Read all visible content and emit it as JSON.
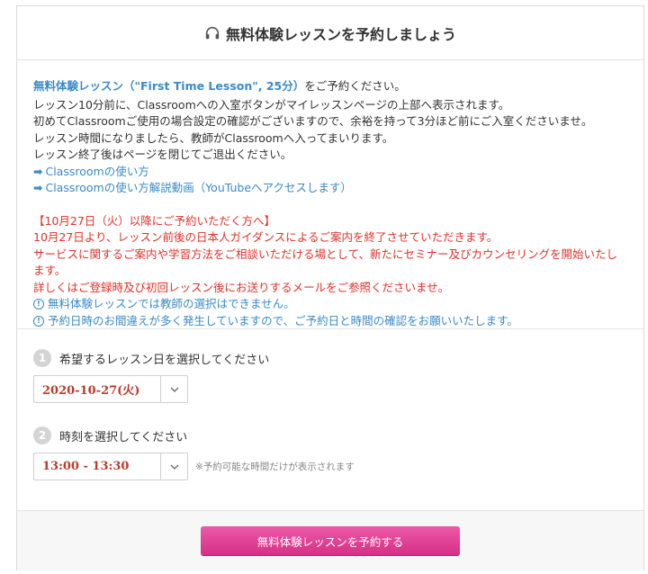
{
  "header": {
    "title": "無料体験レッスンを予約しましょう",
    "icon": "headphones-icon"
  },
  "info": {
    "lead_accent": "無料体験レッスン（\"First Time Lesson\", 25分）",
    "lead_rest": "をご予約ください。",
    "lines": [
      "レッスン10分前に、Classroomへの入室ボタンがマイレッスンページの上部へ表示されます。",
      "初めてClassroomご使用の場合設定の確認がございますので、余裕を持って3分ほど前にご入室くださいませ。",
      "レッスン時間になりましたら、教師がClassroomへ入ってまいります。",
      "レッスン終了後はページを閉じてご退出ください。"
    ],
    "links": [
      "Classroomの使い方",
      "Classroomの使い方解説動画（YouTubeへアクセスします）"
    ],
    "red_lines": [
      "【10月27日（火）以降にご予約いただく方へ】",
      "10月27日より、レッスン前後の日本人ガイダンスによるご案内を終了させていただきます。",
      "サービスに関するご案内や学習方法をご相談いただける場として、新たにセミナー及びカウンセリングを開始いたします。",
      "詳しくはご登録時及び初回レッスン後にお送りするメールをご参照くださいませ。"
    ],
    "notes": [
      "無料体験レッスンでは教師の選択はできません。",
      "予約日時のお間違えが多く発生していますので、ご予約日と時間の確認をお願いいたします。"
    ]
  },
  "form": {
    "step1": {
      "num": "1",
      "label": "希望するレッスン日を選択してください",
      "value": "2020-10-27(火)"
    },
    "step2": {
      "num": "2",
      "label": "時刻を選択してください",
      "value": "13:00 - 13:30",
      "hint": "※予約可能な時間だけが表示されます"
    }
  },
  "footer": {
    "submit_label": "無料体験レッスンを予約する"
  },
  "colors": {
    "accent_blue": "#3a8ac7",
    "notice_red": "#e0322a",
    "button_pink": "#e0449a"
  }
}
